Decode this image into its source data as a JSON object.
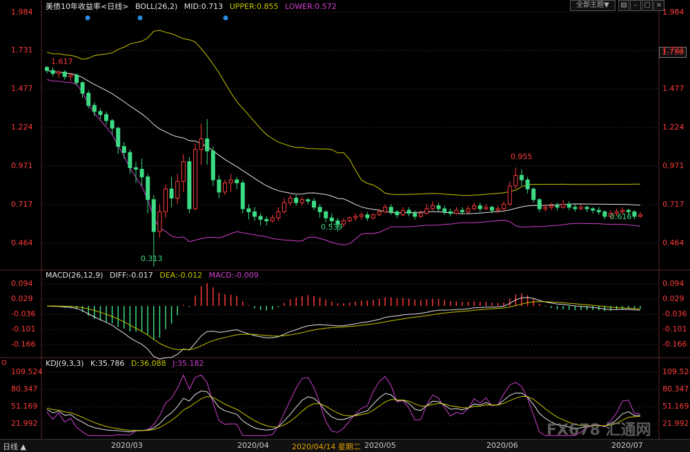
{
  "header": {
    "symbol": "美债10年收益率",
    "period": "<日线>",
    "boll_label": "BOLL(26,2)",
    "boll_mid": "MID:0.713",
    "boll_upper": "UPPER:0.855",
    "boll_lower": "LOWER:0.572",
    "macd_label": "MACD(26,12,9)",
    "macd_diff": "DIFF:-0.017",
    "macd_dea": "DEA:-0.012",
    "macd_macd": "MACD:-0.009",
    "kdj_label": "KDJ(9,3,3)",
    "kdj_k": "K:35.786",
    "kdj_d": "D:36.088",
    "kdj_j": "J:35.182",
    "topic_button": "全部主题▼",
    "price_tag": "1.750"
  },
  "colors": {
    "up": "#ff3b3b",
    "down": "#3ddc84",
    "mid": "#e6e6e6",
    "upper": "#c8c800",
    "lower": "#d040d0",
    "axis_red": "#ff3b3b",
    "grid": "#3a2a2a"
  },
  "footer": {
    "period_tab": "日线",
    "selected_date": "2020/04/14 星期二",
    "months": [
      "2020/03",
      "2020/04",
      "2020/05",
      "2020/06",
      "2020/07"
    ]
  },
  "annotations": {
    "start": "1.617",
    "low1": "0.313",
    "low2": "0.539",
    "high": "0.955",
    "last_low": "0.616"
  },
  "watermark": "FX678 汇通网",
  "chart_data": [
    {
      "type": "candlestick",
      "title": "美债10年收益率 日线",
      "yticks": [
        "1.984",
        "1.731",
        "1.477",
        "1.224",
        "0.971",
        "0.717",
        "0.464"
      ],
      "ylim": [
        0.3,
        2.0
      ],
      "months": [
        "2020/03",
        "2020/04",
        "2020/05",
        "2020/06",
        "2020/07"
      ],
      "series_overlay": [
        "MID",
        "UPPER",
        "LOWER"
      ],
      "candles": [
        [
          1.62,
          1.6,
          1.63,
          1.58
        ],
        [
          1.6,
          1.58,
          1.62,
          1.56
        ],
        [
          1.58,
          1.59,
          1.6,
          1.55
        ],
        [
          1.59,
          1.56,
          1.6,
          1.54
        ],
        [
          1.56,
          1.57,
          1.58,
          1.53
        ],
        [
          1.57,
          1.52,
          1.58,
          1.5
        ],
        [
          1.52,
          1.45,
          1.53,
          1.42
        ],
        [
          1.45,
          1.37,
          1.47,
          1.35
        ],
        [
          1.37,
          1.33,
          1.39,
          1.3
        ],
        [
          1.33,
          1.31,
          1.35,
          1.28
        ],
        [
          1.31,
          1.27,
          1.33,
          1.24
        ],
        [
          1.27,
          1.22,
          1.28,
          1.18
        ],
        [
          1.22,
          1.1,
          1.23,
          1.05
        ],
        [
          1.1,
          1.06,
          1.13,
          1.02
        ],
        [
          1.06,
          0.96,
          1.08,
          0.92
        ],
        [
          0.96,
          0.95,
          1.0,
          0.86
        ],
        [
          0.95,
          0.9,
          1.02,
          0.84
        ],
        [
          0.9,
          0.75,
          0.92,
          0.66
        ],
        [
          0.75,
          0.54,
          0.78,
          0.31
        ],
        [
          0.54,
          0.67,
          0.72,
          0.5
        ],
        [
          0.67,
          0.82,
          0.85,
          0.63
        ],
        [
          0.82,
          0.76,
          0.9,
          0.7
        ],
        [
          0.76,
          0.87,
          0.92,
          0.72
        ],
        [
          0.87,
          1.0,
          1.05,
          0.8
        ],
        [
          1.0,
          0.69,
          1.03,
          0.66
        ],
        [
          0.69,
          1.08,
          1.12,
          0.68
        ],
        [
          1.08,
          1.15,
          1.25,
          0.98
        ],
        [
          1.15,
          1.07,
          1.28,
          0.98
        ],
        [
          1.07,
          0.88,
          1.1,
          0.84
        ],
        [
          0.88,
          0.8,
          0.91,
          0.76
        ],
        [
          0.8,
          0.86,
          0.88,
          0.78
        ],
        [
          0.86,
          0.88,
          0.92,
          0.8
        ],
        [
          0.88,
          0.86,
          0.9,
          0.82
        ],
        [
          0.86,
          0.69,
          0.88,
          0.66
        ],
        [
          0.69,
          0.67,
          0.72,
          0.62
        ],
        [
          0.67,
          0.64,
          0.7,
          0.61
        ],
        [
          0.64,
          0.62,
          0.66,
          0.58
        ],
        [
          0.62,
          0.61,
          0.64,
          0.58
        ],
        [
          0.61,
          0.63,
          0.65,
          0.6
        ],
        [
          0.63,
          0.67,
          0.7,
          0.61
        ],
        [
          0.67,
          0.73,
          0.76,
          0.66
        ],
        [
          0.73,
          0.76,
          0.78,
          0.71
        ],
        [
          0.76,
          0.73,
          0.78,
          0.71
        ],
        [
          0.73,
          0.75,
          0.77,
          0.71
        ],
        [
          0.75,
          0.74,
          0.76,
          0.72
        ],
        [
          0.74,
          0.7,
          0.76,
          0.68
        ],
        [
          0.7,
          0.67,
          0.72,
          0.63
        ],
        [
          0.67,
          0.63,
          0.68,
          0.6
        ],
        [
          0.63,
          0.61,
          0.66,
          0.58
        ],
        [
          0.61,
          0.59,
          0.63,
          0.54
        ],
        [
          0.59,
          0.61,
          0.63,
          0.57
        ],
        [
          0.61,
          0.63,
          0.64,
          0.6
        ],
        [
          0.63,
          0.64,
          0.66,
          0.61
        ],
        [
          0.64,
          0.65,
          0.67,
          0.62
        ],
        [
          0.65,
          0.63,
          0.67,
          0.61
        ],
        [
          0.63,
          0.65,
          0.66,
          0.62
        ],
        [
          0.65,
          0.67,
          0.69,
          0.64
        ],
        [
          0.67,
          0.7,
          0.72,
          0.66
        ],
        [
          0.7,
          0.67,
          0.72,
          0.65
        ],
        [
          0.67,
          0.65,
          0.68,
          0.63
        ],
        [
          0.65,
          0.68,
          0.7,
          0.64
        ],
        [
          0.68,
          0.66,
          0.7,
          0.64
        ],
        [
          0.66,
          0.64,
          0.68,
          0.62
        ],
        [
          0.64,
          0.66,
          0.68,
          0.63
        ],
        [
          0.66,
          0.69,
          0.72,
          0.65
        ],
        [
          0.69,
          0.71,
          0.74,
          0.68
        ],
        [
          0.71,
          0.69,
          0.73,
          0.67
        ],
        [
          0.69,
          0.67,
          0.71,
          0.65
        ],
        [
          0.67,
          0.66,
          0.69,
          0.64
        ],
        [
          0.66,
          0.68,
          0.7,
          0.65
        ],
        [
          0.68,
          0.67,
          0.7,
          0.65
        ],
        [
          0.67,
          0.69,
          0.71,
          0.66
        ],
        [
          0.69,
          0.71,
          0.73,
          0.68
        ],
        [
          0.71,
          0.69,
          0.73,
          0.67
        ],
        [
          0.69,
          0.7,
          0.72,
          0.68
        ],
        [
          0.7,
          0.68,
          0.71,
          0.66
        ],
        [
          0.68,
          0.69,
          0.71,
          0.66
        ],
        [
          0.69,
          0.72,
          0.74,
          0.68
        ],
        [
          0.72,
          0.84,
          0.87,
          0.71
        ],
        [
          0.84,
          0.91,
          0.96,
          0.82
        ],
        [
          0.91,
          0.88,
          0.95,
          0.84
        ],
        [
          0.88,
          0.82,
          0.9,
          0.79
        ],
        [
          0.82,
          0.75,
          0.83,
          0.73
        ],
        [
          0.75,
          0.69,
          0.76,
          0.67
        ],
        [
          0.69,
          0.7,
          0.72,
          0.67
        ],
        [
          0.7,
          0.71,
          0.73,
          0.68
        ],
        [
          0.71,
          0.7,
          0.73,
          0.68
        ],
        [
          0.7,
          0.72,
          0.75,
          0.69
        ],
        [
          0.72,
          0.7,
          0.74,
          0.68
        ],
        [
          0.7,
          0.69,
          0.72,
          0.67
        ],
        [
          0.69,
          0.7,
          0.72,
          0.68
        ],
        [
          0.7,
          0.69,
          0.71,
          0.67
        ],
        [
          0.69,
          0.68,
          0.7,
          0.66
        ],
        [
          0.68,
          0.67,
          0.7,
          0.65
        ],
        [
          0.67,
          0.64,
          0.68,
          0.62
        ],
        [
          0.64,
          0.66,
          0.68,
          0.62
        ],
        [
          0.66,
          0.67,
          0.69,
          0.64
        ],
        [
          0.67,
          0.68,
          0.7,
          0.65
        ],
        [
          0.68,
          0.67,
          0.69,
          0.65
        ],
        [
          0.67,
          0.64,
          0.68,
          0.62
        ],
        [
          0.64,
          0.65,
          0.67,
          0.63
        ]
      ]
    },
    {
      "type": "macd",
      "yticks": [
        "0.094",
        "0.029",
        "-0.036",
        "-0.101",
        "-0.166"
      ],
      "ylim": [
        -0.215,
        0.115
      ]
    },
    {
      "type": "kdj",
      "yticks": [
        "109.524",
        "80.347",
        "51.169",
        "21.992"
      ],
      "ylim": [
        0,
        118
      ]
    }
  ]
}
